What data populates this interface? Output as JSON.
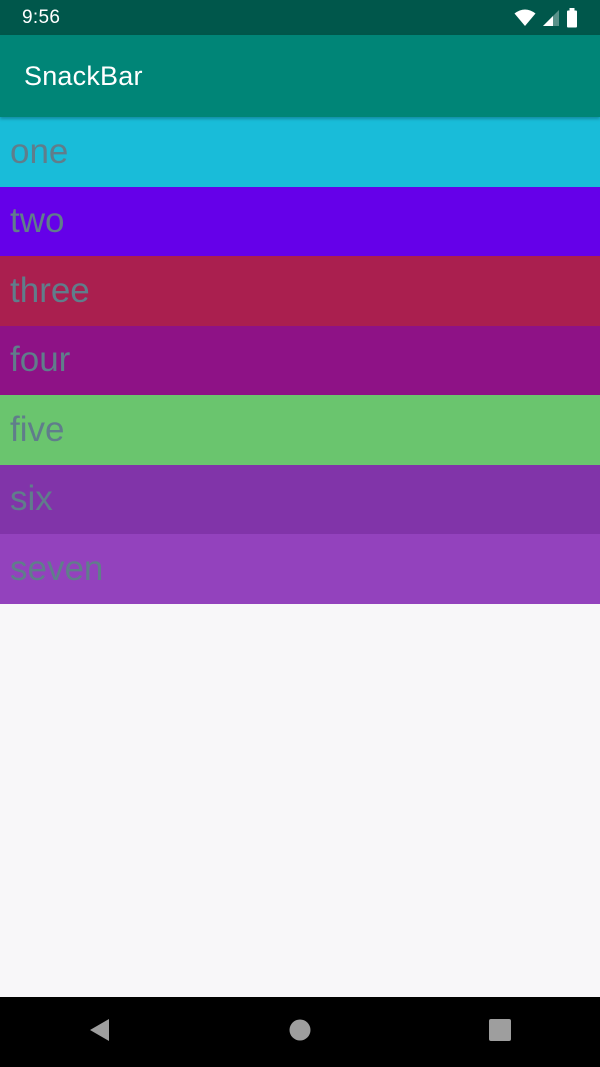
{
  "status_bar": {
    "time": "9:56",
    "icons": [
      "wifi-icon",
      "cell-signal-icon",
      "battery-icon"
    ]
  },
  "app_bar": {
    "title": "SnackBar",
    "color": "#008577"
  },
  "list": {
    "items": [
      {
        "label": "one",
        "color": "#19BCD9"
      },
      {
        "label": "two",
        "color": "#6500E9"
      },
      {
        "label": "three",
        "color": "#AA1F4F"
      },
      {
        "label": "four",
        "color": "#8E1286"
      },
      {
        "label": "five",
        "color": "#6AC56E"
      },
      {
        "label": "six",
        "color": "#8134A9"
      },
      {
        "label": "seven",
        "color": "#9342BD"
      }
    ],
    "text_color": "#607D8B"
  },
  "nav_bar": {
    "buttons": [
      "back-icon",
      "home-icon",
      "recents-icon"
    ]
  }
}
